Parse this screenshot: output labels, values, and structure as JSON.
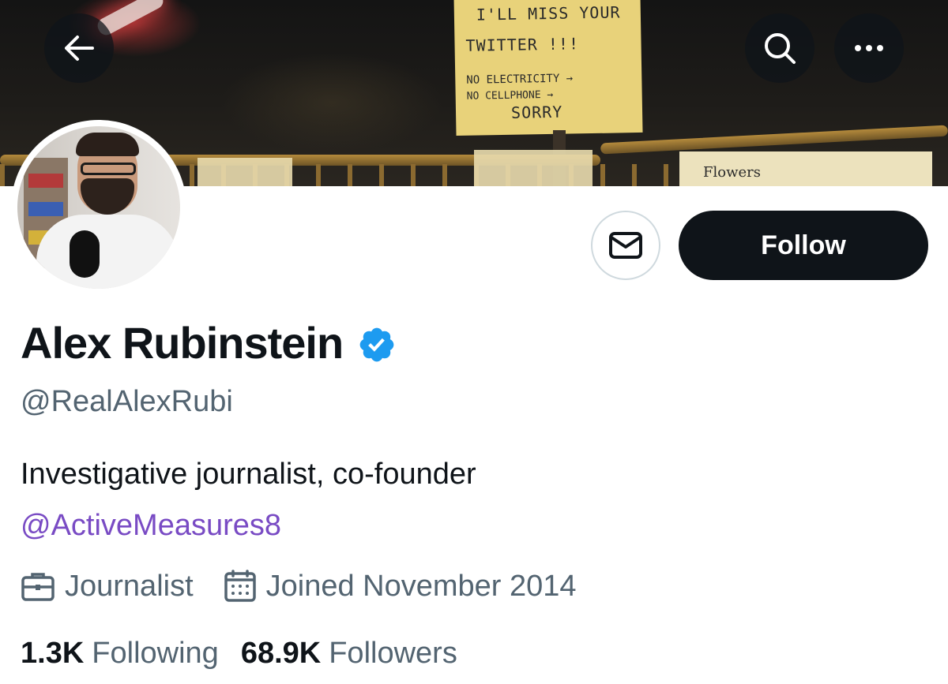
{
  "banner": {
    "sign_lines": [
      "I'LL MISS YOUR",
      "TWITTER !!!",
      "NO ELECTRICITY →",
      "NO CELLPHONE →",
      "SORRY"
    ],
    "flowers_text": "Flowers"
  },
  "nav": {
    "back_icon": "arrow-left-icon",
    "search_icon": "search-icon",
    "more_icon": "more-horizontal-icon"
  },
  "actions": {
    "message_icon": "envelope-icon",
    "follow_label": "Follow"
  },
  "profile": {
    "display_name": "Alex Rubinstein",
    "verified_icon": "verified-badge-icon",
    "handle": "@RealAlexRubi",
    "bio": "Investigative journalist, co-founder",
    "bio_link": "@ActiveMeasures8",
    "profession": "Journalist",
    "joined": "Joined November 2014",
    "following_count": "1.3K",
    "following_label": "Following",
    "followers_count": "68.9K",
    "followers_label": "Followers"
  },
  "colors": {
    "text_primary": "#0f1419",
    "text_secondary": "#536471",
    "link_purple": "#794bc4",
    "verified_blue": "#1d9bf0",
    "follow_bg": "#0f1419"
  }
}
